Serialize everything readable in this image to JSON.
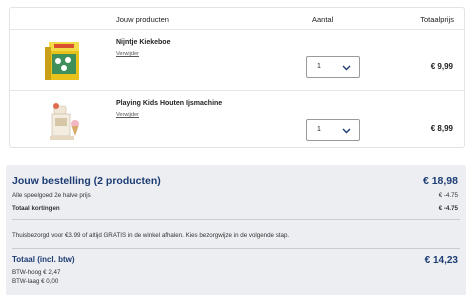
{
  "cart": {
    "header": {
      "products": "Jouw producten",
      "quantity": "Aantal",
      "total": "Totaalprijs"
    },
    "items": [
      {
        "name": "Nijntje Kiekeboe",
        "remove_label": "Verwijder",
        "quantity": "1",
        "price": "€ 9,99",
        "image": "nijntje-box-icon"
      },
      {
        "name": "Playing Kids Houten Ijsmachine",
        "remove_label": "Verwijder",
        "quantity": "1",
        "price": "€ 8,99",
        "image": "ice-cream-machine-icon"
      }
    ]
  },
  "summary": {
    "title": "Jouw bestelling (2 producten)",
    "title_amount": "€ 18,98",
    "discount_line": "Alle speelgoed 2e halve prijs",
    "discount_amount": "€ -4.75",
    "discount_total_label": "Totaal kortingen",
    "discount_total_amount": "€ -4.75",
    "delivery_note": "Thuisbezorgd voor €3.99 of altijd GRATIS in de winkel afhalen. Kies bezorgwijze in de volgende stap.",
    "total_label": "Totaal (incl. btw)",
    "total_amount": "€ 14,23",
    "vat_high": "BTW-hoog € 2,47",
    "vat_low": "BTW-laag € 0,00"
  },
  "colors": {
    "accent": "#1d3c73",
    "summary_bg": "#eceef2"
  }
}
